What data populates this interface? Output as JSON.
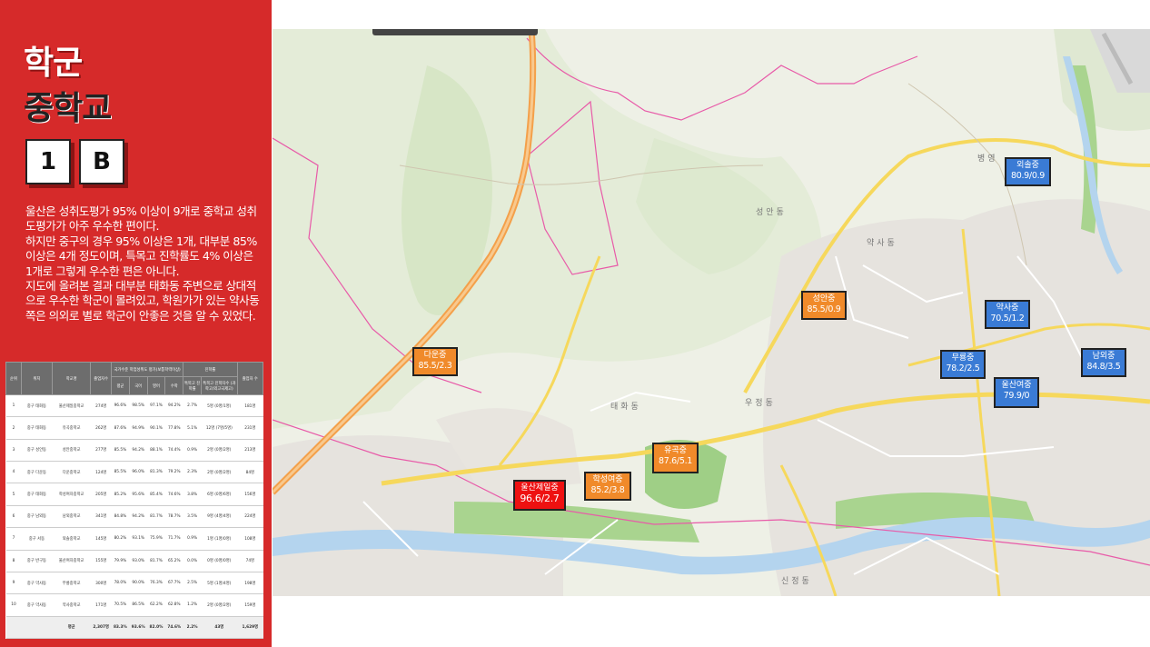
{
  "sidebar": {
    "title_line1": "학군",
    "title_line2": "중학교",
    "badge1": "1",
    "badge2": "B",
    "description": [
      "울산은 성취도평가 95% 이상이 9개로 중학교 성취도평가가 아주 우수한 편이다.",
      "하지만 중구의 경우 95% 이상은 1개, 대부분 85% 이상은 4개 정도이며, 특목고 진학률도 4% 이상은 1개로 그렇게 우수한 편은 아니다.",
      "지도에 올려본 결과 대부분 태화동 주변으로 상대적으로 우수한 학군이 몰려있고, 학원가가 있는 약사동 쪽은 의외로 별로 학군이 안좋은 것을 알 수 있었다."
    ]
  },
  "table": {
    "headers": {
      "rank": "순위",
      "region": "위치",
      "school": "학교명",
      "students": "졸업자수",
      "group_achievement": "국가수준 학업성취도 평가(보통학력이상)",
      "avg": "평균",
      "korean": "국어",
      "english": "영어",
      "math": "수학",
      "special_rate": "특목고 진학률",
      "group_advance": "진학률",
      "special_count": "특목고 진학자수 (과학고/외고국제고)",
      "graduates": "졸업자 수"
    },
    "rows": [
      [
        "1",
        "중구 태화동",
        "울산제일중학교",
        "274명",
        "96.6%",
        "98.5%",
        "97.1%",
        "94.2%",
        "2.7%",
        "5명 (0명/1명)",
        "181명"
      ],
      [
        "2",
        "중구 태화동",
        "유곡중학교",
        "262명",
        "87.6%",
        "94.9%",
        "90.1%",
        "77.8%",
        "5.1%",
        "12명 (7명/5명)",
        "231명"
      ],
      [
        "3",
        "중구 성안동",
        "성안중학교",
        "277명",
        "85.5%",
        "94.2%",
        "88.1%",
        "74.4%",
        "0.9%",
        "2명 (0명/2명)",
        "213명"
      ],
      [
        "4",
        "중구 다운동",
        "다운중학교",
        "124명",
        "85.5%",
        "96.0%",
        "81.3%",
        "79.2%",
        "2.3%",
        "2명 (0명/2명)",
        "84명"
      ],
      [
        "5",
        "중구 태화동",
        "학성여자중학교",
        "205명",
        "85.2%",
        "95.6%",
        "85.4%",
        "74.6%",
        "3.8%",
        "6명 (0명/6명)",
        "156명"
      ],
      [
        "6",
        "중구 남외동",
        "남외중학교",
        "341명",
        "84.8%",
        "94.2%",
        "81.7%",
        "78.7%",
        "3.5%",
        "9명 (4명/4명)",
        "224명"
      ],
      [
        "7",
        "중구 서동",
        "외솔중학교",
        "145명",
        "80.2%",
        "93.1%",
        "75.9%",
        "71.7%",
        "0.9%",
        "1명 (1명/0명)",
        "108명"
      ],
      [
        "8",
        "중구 반구동",
        "울산여자중학교",
        "155명",
        "79.9%",
        "93.0%",
        "81.7%",
        "65.2%",
        "0.0%",
        "0명 (0명/0명)",
        "74명"
      ],
      [
        "9",
        "중구 약사동",
        "무룡중학교",
        "300명",
        "78.0%",
        "90.0%",
        "76.3%",
        "67.7%",
        "2.5%",
        "5명 (1명/4명)",
        "198명"
      ],
      [
        "10",
        "중구 약사동",
        "약사중학교",
        "171명",
        "70.5%",
        "86.5%",
        "62.2%",
        "62.8%",
        "1.2%",
        "2명 (0명/2명)",
        "159명"
      ]
    ],
    "footer": [
      "",
      "",
      "평균",
      "2,307명",
      "83.3%",
      "93.6%",
      "82.0%",
      "74.6%",
      "2.2%",
      "43명",
      "1,629명"
    ]
  },
  "map": {
    "district_labels": [
      "성안동",
      "약사동",
      "병영",
      "태화동",
      "우정동",
      "신정동"
    ],
    "schools": [
      {
        "name": "외솔중",
        "value": "80.9/0.9",
        "color": "blue"
      },
      {
        "name": "성안중",
        "value": "85.5/0.9",
        "color": "orange"
      },
      {
        "name": "약사중",
        "value": "70.5/1.2",
        "color": "blue"
      },
      {
        "name": "다운중",
        "value": "85.5/2.3",
        "color": "orange"
      },
      {
        "name": "무룡중",
        "value": "78.2/2.5",
        "color": "blue"
      },
      {
        "name": "남외중",
        "value": "84.8/3.5",
        "color": "blue"
      },
      {
        "name": "울산여중",
        "value": "79.9/0",
        "color": "blue"
      },
      {
        "name": "유곡중",
        "value": "87.6/5.1",
        "color": "orange"
      },
      {
        "name": "학성여중",
        "value": "85.2/3.8",
        "color": "orange"
      },
      {
        "name": "울산제일중",
        "value": "96.6/2.7",
        "color": "red"
      }
    ],
    "colors": {
      "blue": "#3a7bd5",
      "orange": "#f08a2a",
      "red": "#ee1111",
      "sidebar": "#d62a2a"
    }
  }
}
